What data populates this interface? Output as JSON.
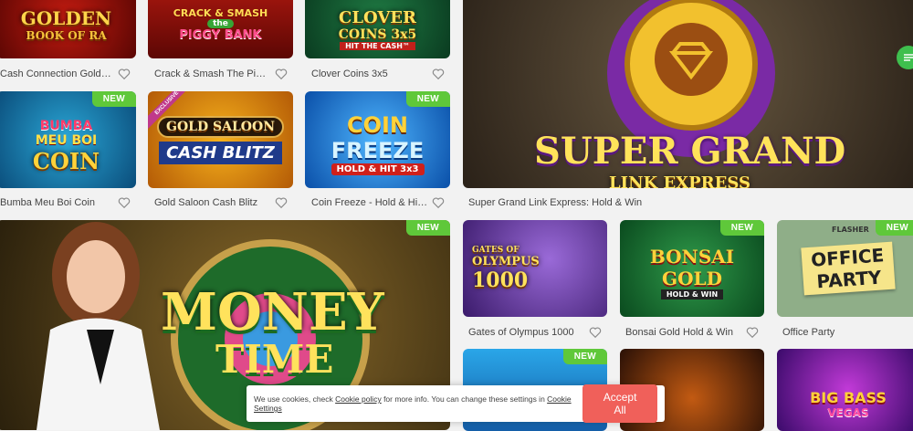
{
  "badges": {
    "new": "NEW",
    "exclusive": "EXCLUSIVE"
  },
  "games": [
    {
      "id": "golden-book",
      "logo": [
        "GOLDEN",
        "BOOK OF RA"
      ],
      "caption": "Cash Connection Golde..."
    },
    {
      "id": "crack-smash",
      "logo": [
        "CRACK & SMASH",
        "the",
        "PIGGY BANK"
      ],
      "caption": "Crack & Smash The Pigg..."
    },
    {
      "id": "clover-coins",
      "logo": [
        "CLOVER",
        "COINS 3x5",
        "HIT THE CASH™"
      ],
      "caption": "Clover Coins 3x5"
    },
    {
      "id": "super-grand",
      "logo": [
        "SUPER GRAND",
        "LINK EXPRESS"
      ],
      "caption": "Super Grand Link Express: Hold & Win"
    },
    {
      "id": "bumba",
      "logo": [
        "BUMBA",
        "MEU BOI",
        "COIN"
      ],
      "caption": "Bumba Meu Boi Coin"
    },
    {
      "id": "gold-saloon",
      "logo": [
        "GOLD SALOON",
        "CASH BLITZ"
      ],
      "caption": "Gold Saloon Cash Blitz"
    },
    {
      "id": "coin-freeze",
      "logo": [
        "COIN",
        "FREEZE",
        "HOLD & HIT 3x3"
      ],
      "caption": "Coin Freeze - Hold & Hit ..."
    },
    {
      "id": "money-time",
      "logo": [
        "MONEY",
        "TIME"
      ],
      "caption": ""
    },
    {
      "id": "gates-olympus",
      "logo": [
        "GATES OF",
        "OLYMPUS",
        "1000"
      ],
      "caption": "Gates of Olympus 1000"
    },
    {
      "id": "bonsai-gold",
      "logo": [
        "BONSAI",
        "GOLD",
        "HOLD & WIN"
      ],
      "caption": "Bonsai Gold Hold & Win"
    },
    {
      "id": "office-party",
      "logo": [
        "OFFICE",
        "PARTY",
        "FLASHER"
      ],
      "caption": "Office Party"
    },
    {
      "id": "big-bass",
      "logo": [
        "BIG BASS",
        "VEGAS"
      ],
      "caption": ""
    }
  ],
  "cookie": {
    "text1": "We use cookies, check ",
    "link1": "Cookie policy",
    "text2": " for more info. You can change these settings in ",
    "link2": "Cookie Settings",
    "accept": "Accept All"
  },
  "colors": {
    "new_badge": "#5fc83a",
    "accept": "#f0605a",
    "page_bg": "#f2f2f2"
  },
  "icons": {
    "favorite": "heart-outline-icon",
    "chat": "chat-icon"
  }
}
